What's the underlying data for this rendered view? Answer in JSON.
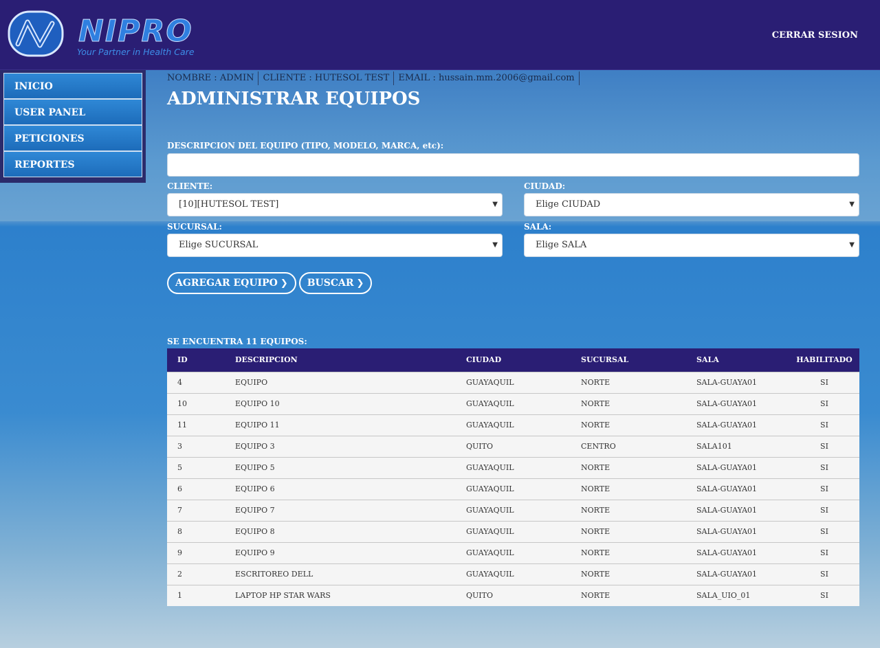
{
  "header": {
    "logo_text": "NIPRO",
    "logo_tagline": "Your Partner in Health Care",
    "logout_label": "CERRAR SESION",
    "brand_color": "#2a1e74"
  },
  "sidebar": {
    "items": [
      {
        "label": "INICIO"
      },
      {
        "label": "USER PANEL"
      },
      {
        "label": "PETICIONES"
      },
      {
        "label": "REPORTES"
      }
    ]
  },
  "userbar": {
    "nombre": "NOMBRE : ADMIN",
    "cliente": "CLIENTE : HUTESOL TEST",
    "email": "EMAIL : hussain.mm.2006@gmail.com"
  },
  "page_title": "ADMINISTRAR EQUIPOS",
  "form": {
    "descripcion_label": "DESCRIPCION DEL EQUIPO (TIPO, MODELO, MARCA, etc):",
    "descripcion_value": "",
    "cliente_label": "CLIENTE:",
    "cliente_value": "[10][HUTESOL TEST]",
    "ciudad_label": "CIUDAD:",
    "ciudad_value": "Elige CIUDAD",
    "sucursal_label": "SUCURSAL:",
    "sucursal_value": "Elige SUCURSAL",
    "sala_label": "SALA:",
    "sala_value": "Elige SALA",
    "agregar_label": "AGREGAR EQUIPO",
    "buscar_label": "BUSCAR"
  },
  "results": {
    "count_label": "SE ENCUENTRA 11 EQUIPOS:",
    "columns": [
      "ID",
      "DESCRIPCION",
      "CIUDAD",
      "SUCURSAL",
      "SALA",
      "HABILITADO"
    ],
    "rows": [
      [
        "4",
        "EQUIPO",
        "GUAYAQUIL",
        "NORTE",
        "SALA-GUAYA01",
        "SI"
      ],
      [
        "10",
        "EQUIPO 10",
        "GUAYAQUIL",
        "NORTE",
        "SALA-GUAYA01",
        "SI"
      ],
      [
        "11",
        "EQUIPO 11",
        "GUAYAQUIL",
        "NORTE",
        "SALA-GUAYA01",
        "SI"
      ],
      [
        "3",
        "EQUIPO 3",
        "QUITO",
        "CENTRO",
        "SALA101",
        "SI"
      ],
      [
        "5",
        "EQUIPO 5",
        "GUAYAQUIL",
        "NORTE",
        "SALA-GUAYA01",
        "SI"
      ],
      [
        "6",
        "EQUIPO 6",
        "GUAYAQUIL",
        "NORTE",
        "SALA-GUAYA01",
        "SI"
      ],
      [
        "7",
        "EQUIPO 7",
        "GUAYAQUIL",
        "NORTE",
        "SALA-GUAYA01",
        "SI"
      ],
      [
        "8",
        "EQUIPO 8",
        "GUAYAQUIL",
        "NORTE",
        "SALA-GUAYA01",
        "SI"
      ],
      [
        "9",
        "EQUIPO 9",
        "GUAYAQUIL",
        "NORTE",
        "SALA-GUAYA01",
        "SI"
      ],
      [
        "2",
        "ESCRITOREO DELL",
        "GUAYAQUIL",
        "NORTE",
        "SALA-GUAYA01",
        "SI"
      ],
      [
        "1",
        "LAPTOP HP STAR WARS",
        "QUITO",
        "NORTE",
        "SALA_UIO_01",
        "SI"
      ]
    ]
  }
}
